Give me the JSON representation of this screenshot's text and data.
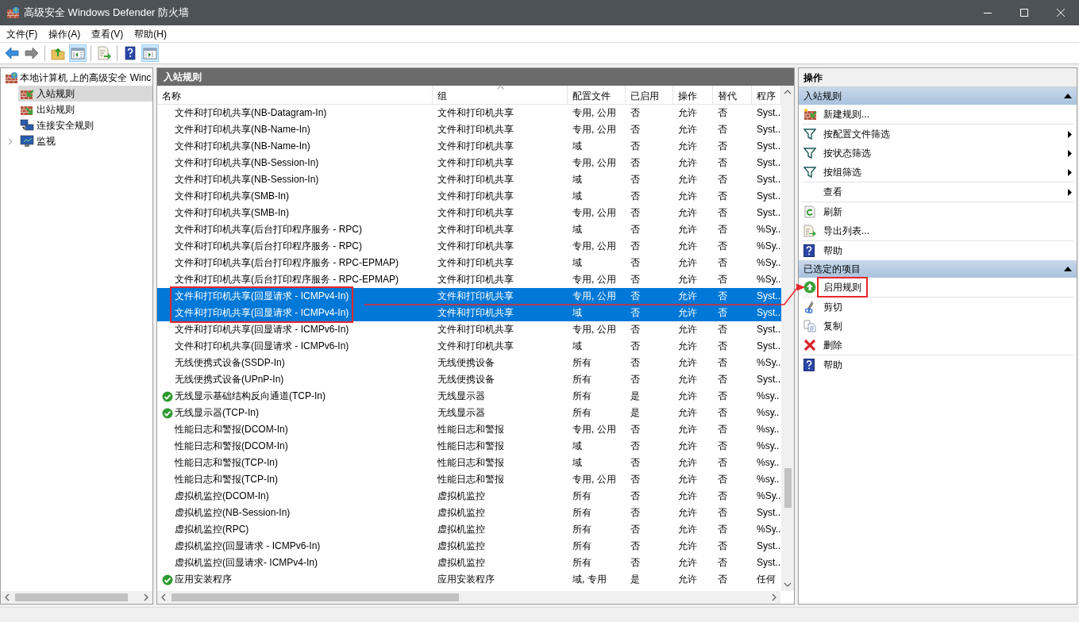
{
  "window": {
    "title": "高级安全 Windows Defender 防火墙"
  },
  "menu": [
    "文件(F)",
    "操作(A)",
    "查看(V)",
    "帮助(H)"
  ],
  "toolbar": [
    {
      "pressed": false
    },
    {
      "pressed": false
    },
    {
      "pressed": false
    },
    {
      "pressed": true
    },
    {
      "pressed": false
    },
    {
      "pressed": false
    },
    {
      "pressed": true
    }
  ],
  "tree": {
    "label": "本地计算机 上的高级安全 Winc",
    "children": [
      {
        "label": "入站规则",
        "selected": true,
        "expandable": false
      },
      {
        "label": "出站规则",
        "selected": false,
        "expandable": false
      },
      {
        "label": "连接安全规则",
        "selected": false,
        "expandable": false
      },
      {
        "label": "监视",
        "selected": false,
        "expandable": true
      }
    ]
  },
  "rules_panel": {
    "title": "入站规则",
    "columns": [
      {
        "label": "名称",
        "sorted": false
      },
      {
        "label": "组",
        "sorted": true
      },
      {
        "label": "配置文件",
        "sorted": false
      },
      {
        "label": "已启用",
        "sorted": false
      },
      {
        "label": "操作",
        "sorted": false
      },
      {
        "label": "替代",
        "sorted": false
      },
      {
        "label": "程序",
        "sorted": false
      }
    ],
    "rows": [
      {
        "name": "文件和打印机共享(NB-Datagram-In)",
        "group": "文件和打印机共享",
        "profile": "专用, 公用",
        "enabled_text": "否",
        "enabled": false,
        "action": "允许",
        "override": "否",
        "program": "Syst..",
        "selected": false
      },
      {
        "name": "文件和打印机共享(NB-Name-In)",
        "group": "文件和打印机共享",
        "profile": "专用, 公用",
        "enabled_text": "否",
        "enabled": false,
        "action": "允许",
        "override": "否",
        "program": "Syst..",
        "selected": false
      },
      {
        "name": "文件和打印机共享(NB-Name-In)",
        "group": "文件和打印机共享",
        "profile": "域",
        "enabled_text": "否",
        "enabled": false,
        "action": "允许",
        "override": "否",
        "program": "Syst..",
        "selected": false
      },
      {
        "name": "文件和打印机共享(NB-Session-In)",
        "group": "文件和打印机共享",
        "profile": "专用, 公用",
        "enabled_text": "否",
        "enabled": false,
        "action": "允许",
        "override": "否",
        "program": "Syst..",
        "selected": false
      },
      {
        "name": "文件和打印机共享(NB-Session-In)",
        "group": "文件和打印机共享",
        "profile": "域",
        "enabled_text": "否",
        "enabled": false,
        "action": "允许",
        "override": "否",
        "program": "Syst..",
        "selected": false
      },
      {
        "name": "文件和打印机共享(SMB-In)",
        "group": "文件和打印机共享",
        "profile": "域",
        "enabled_text": "否",
        "enabled": false,
        "action": "允许",
        "override": "否",
        "program": "Syst..",
        "selected": false
      },
      {
        "name": "文件和打印机共享(SMB-In)",
        "group": "文件和打印机共享",
        "profile": "专用, 公用",
        "enabled_text": "否",
        "enabled": false,
        "action": "允许",
        "override": "否",
        "program": "Syst..",
        "selected": false
      },
      {
        "name": "文件和打印机共享(后台打印程序服务 - RPC)",
        "group": "文件和打印机共享",
        "profile": "域",
        "enabled_text": "否",
        "enabled": false,
        "action": "允许",
        "override": "否",
        "program": "%Sy..",
        "selected": false
      },
      {
        "name": "文件和打印机共享(后台打印程序服务 - RPC)",
        "group": "文件和打印机共享",
        "profile": "专用, 公用",
        "enabled_text": "否",
        "enabled": false,
        "action": "允许",
        "override": "否",
        "program": "%Sy..",
        "selected": false
      },
      {
        "name": "文件和打印机共享(后台打印程序服务 - RPC-EPMAP)",
        "group": "文件和打印机共享",
        "profile": "域",
        "enabled_text": "否",
        "enabled": false,
        "action": "允许",
        "override": "否",
        "program": "%Sy..",
        "selected": false
      },
      {
        "name": "文件和打印机共享(后台打印程序服务 - RPC-EPMAP)",
        "group": "文件和打印机共享",
        "profile": "专用, 公用",
        "enabled_text": "否",
        "enabled": false,
        "action": "允许",
        "override": "否",
        "program": "%Sy..",
        "selected": false
      },
      {
        "name": "文件和打印机共享(回显请求 - ICMPv4-In)",
        "group": "文件和打印机共享",
        "profile": "专用, 公用",
        "enabled_text": "否",
        "enabled": false,
        "action": "允许",
        "override": "否",
        "program": "Syst..",
        "selected": true
      },
      {
        "name": "文件和打印机共享(回显请求 - ICMPv4-In)",
        "group": "文件和打印机共享",
        "profile": "域",
        "enabled_text": "否",
        "enabled": false,
        "action": "允许",
        "override": "否",
        "program": "Syst..",
        "selected": true
      },
      {
        "name": "文件和打印机共享(回显请求 - ICMPv6-In)",
        "group": "文件和打印机共享",
        "profile": "专用, 公用",
        "enabled_text": "否",
        "enabled": false,
        "action": "允许",
        "override": "否",
        "program": "Syst..",
        "selected": false
      },
      {
        "name": "文件和打印机共享(回显请求 - ICMPv6-In)",
        "group": "文件和打印机共享",
        "profile": "域",
        "enabled_text": "否",
        "enabled": false,
        "action": "允许",
        "override": "否",
        "program": "Syst..",
        "selected": false
      },
      {
        "name": "无线便携式设备(SSDP-In)",
        "group": "无线便携设备",
        "profile": "所有",
        "enabled_text": "否",
        "enabled": false,
        "action": "允许",
        "override": "否",
        "program": "%Sy..",
        "selected": false
      },
      {
        "name": "无线便携式设备(UPnP-In)",
        "group": "无线便携设备",
        "profile": "所有",
        "enabled_text": "否",
        "enabled": false,
        "action": "允许",
        "override": "否",
        "program": "Syst..",
        "selected": false
      },
      {
        "name": "无线显示基础结构反向通道(TCP-In)",
        "group": "无线显示器",
        "profile": "所有",
        "enabled_text": "是",
        "enabled": true,
        "action": "允许",
        "override": "否",
        "program": "%sy..",
        "selected": false
      },
      {
        "name": "无线显示器(TCP-In)",
        "group": "无线显示器",
        "profile": "所有",
        "enabled_text": "是",
        "enabled": true,
        "action": "允许",
        "override": "否",
        "program": "%sy..",
        "selected": false
      },
      {
        "name": "性能日志和警报(DCOM-In)",
        "group": "性能日志和警报",
        "profile": "专用, 公用",
        "enabled_text": "否",
        "enabled": false,
        "action": "允许",
        "override": "否",
        "program": "%sy..",
        "selected": false
      },
      {
        "name": "性能日志和警报(DCOM-In)",
        "group": "性能日志和警报",
        "profile": "域",
        "enabled_text": "否",
        "enabled": false,
        "action": "允许",
        "override": "否",
        "program": "%sy..",
        "selected": false
      },
      {
        "name": "性能日志和警报(TCP-In)",
        "group": "性能日志和警报",
        "profile": "域",
        "enabled_text": "否",
        "enabled": false,
        "action": "允许",
        "override": "否",
        "program": "%sy..",
        "selected": false
      },
      {
        "name": "性能日志和警报(TCP-In)",
        "group": "性能日志和警报",
        "profile": "专用, 公用",
        "enabled_text": "否",
        "enabled": false,
        "action": "允许",
        "override": "否",
        "program": "%sy..",
        "selected": false
      },
      {
        "name": "虚拟机监控(DCOM-In)",
        "group": "虚拟机监控",
        "profile": "所有",
        "enabled_text": "否",
        "enabled": false,
        "action": "允许",
        "override": "否",
        "program": "%Sy..",
        "selected": false
      },
      {
        "name": "虚拟机监控(NB-Session-In)",
        "group": "虚拟机监控",
        "profile": "所有",
        "enabled_text": "否",
        "enabled": false,
        "action": "允许",
        "override": "否",
        "program": "Syst..",
        "selected": false
      },
      {
        "name": "虚拟机监控(RPC)",
        "group": "虚拟机监控",
        "profile": "所有",
        "enabled_text": "否",
        "enabled": false,
        "action": "允许",
        "override": "否",
        "program": "%Sy..",
        "selected": false
      },
      {
        "name": "虚拟机监控(回显请求 - ICMPv6-In)",
        "group": "虚拟机监控",
        "profile": "所有",
        "enabled_text": "否",
        "enabled": false,
        "action": "允许",
        "override": "否",
        "program": "Syst..",
        "selected": false
      },
      {
        "name": "虚拟机监控(回显请求- ICMPv4-In)",
        "group": "虚拟机监控",
        "profile": "所有",
        "enabled_text": "否",
        "enabled": false,
        "action": "允许",
        "override": "否",
        "program": "Syst..",
        "selected": false
      },
      {
        "name": "应用安装程序",
        "group": "应用安装程序",
        "profile": "域, 专用",
        "enabled_text": "是",
        "enabled": true,
        "action": "允许",
        "override": "否",
        "program": "任何",
        "selected": false
      }
    ]
  },
  "actions_panel": {
    "title": "操作",
    "sections": [
      {
        "title": "入站规则",
        "expanded": true,
        "groups": [
          [
            {
              "label": "新建规则...",
              "kind": "newrule",
              "submenu": false
            }
          ],
          [
            {
              "label": "按配置文件筛选",
              "kind": "filter",
              "submenu": true
            },
            {
              "label": "按状态筛选",
              "kind": "filter",
              "submenu": true
            },
            {
              "label": "按组筛选",
              "kind": "filter",
              "submenu": true
            }
          ],
          [
            {
              "label": "查看",
              "kind": "none",
              "submenu": true
            }
          ],
          [
            {
              "label": "刷新",
              "kind": "refresh",
              "submenu": false
            },
            {
              "label": "导出列表...",
              "kind": "export",
              "submenu": false
            }
          ],
          [
            {
              "label": "帮助",
              "kind": "help",
              "submenu": false
            }
          ]
        ]
      },
      {
        "title": "已选定的项目",
        "expanded": true,
        "groups": [
          [
            {
              "label": "启用规则",
              "kind": "enable",
              "submenu": false
            }
          ],
          [
            {
              "label": "剪切",
              "kind": "cut",
              "submenu": false
            },
            {
              "label": "复制",
              "kind": "copy",
              "submenu": false
            },
            {
              "label": "删除",
              "kind": "delete",
              "submenu": false
            }
          ],
          [
            {
              "label": "帮助",
              "kind": "help",
              "submenu": false
            }
          ]
        ]
      }
    ]
  }
}
